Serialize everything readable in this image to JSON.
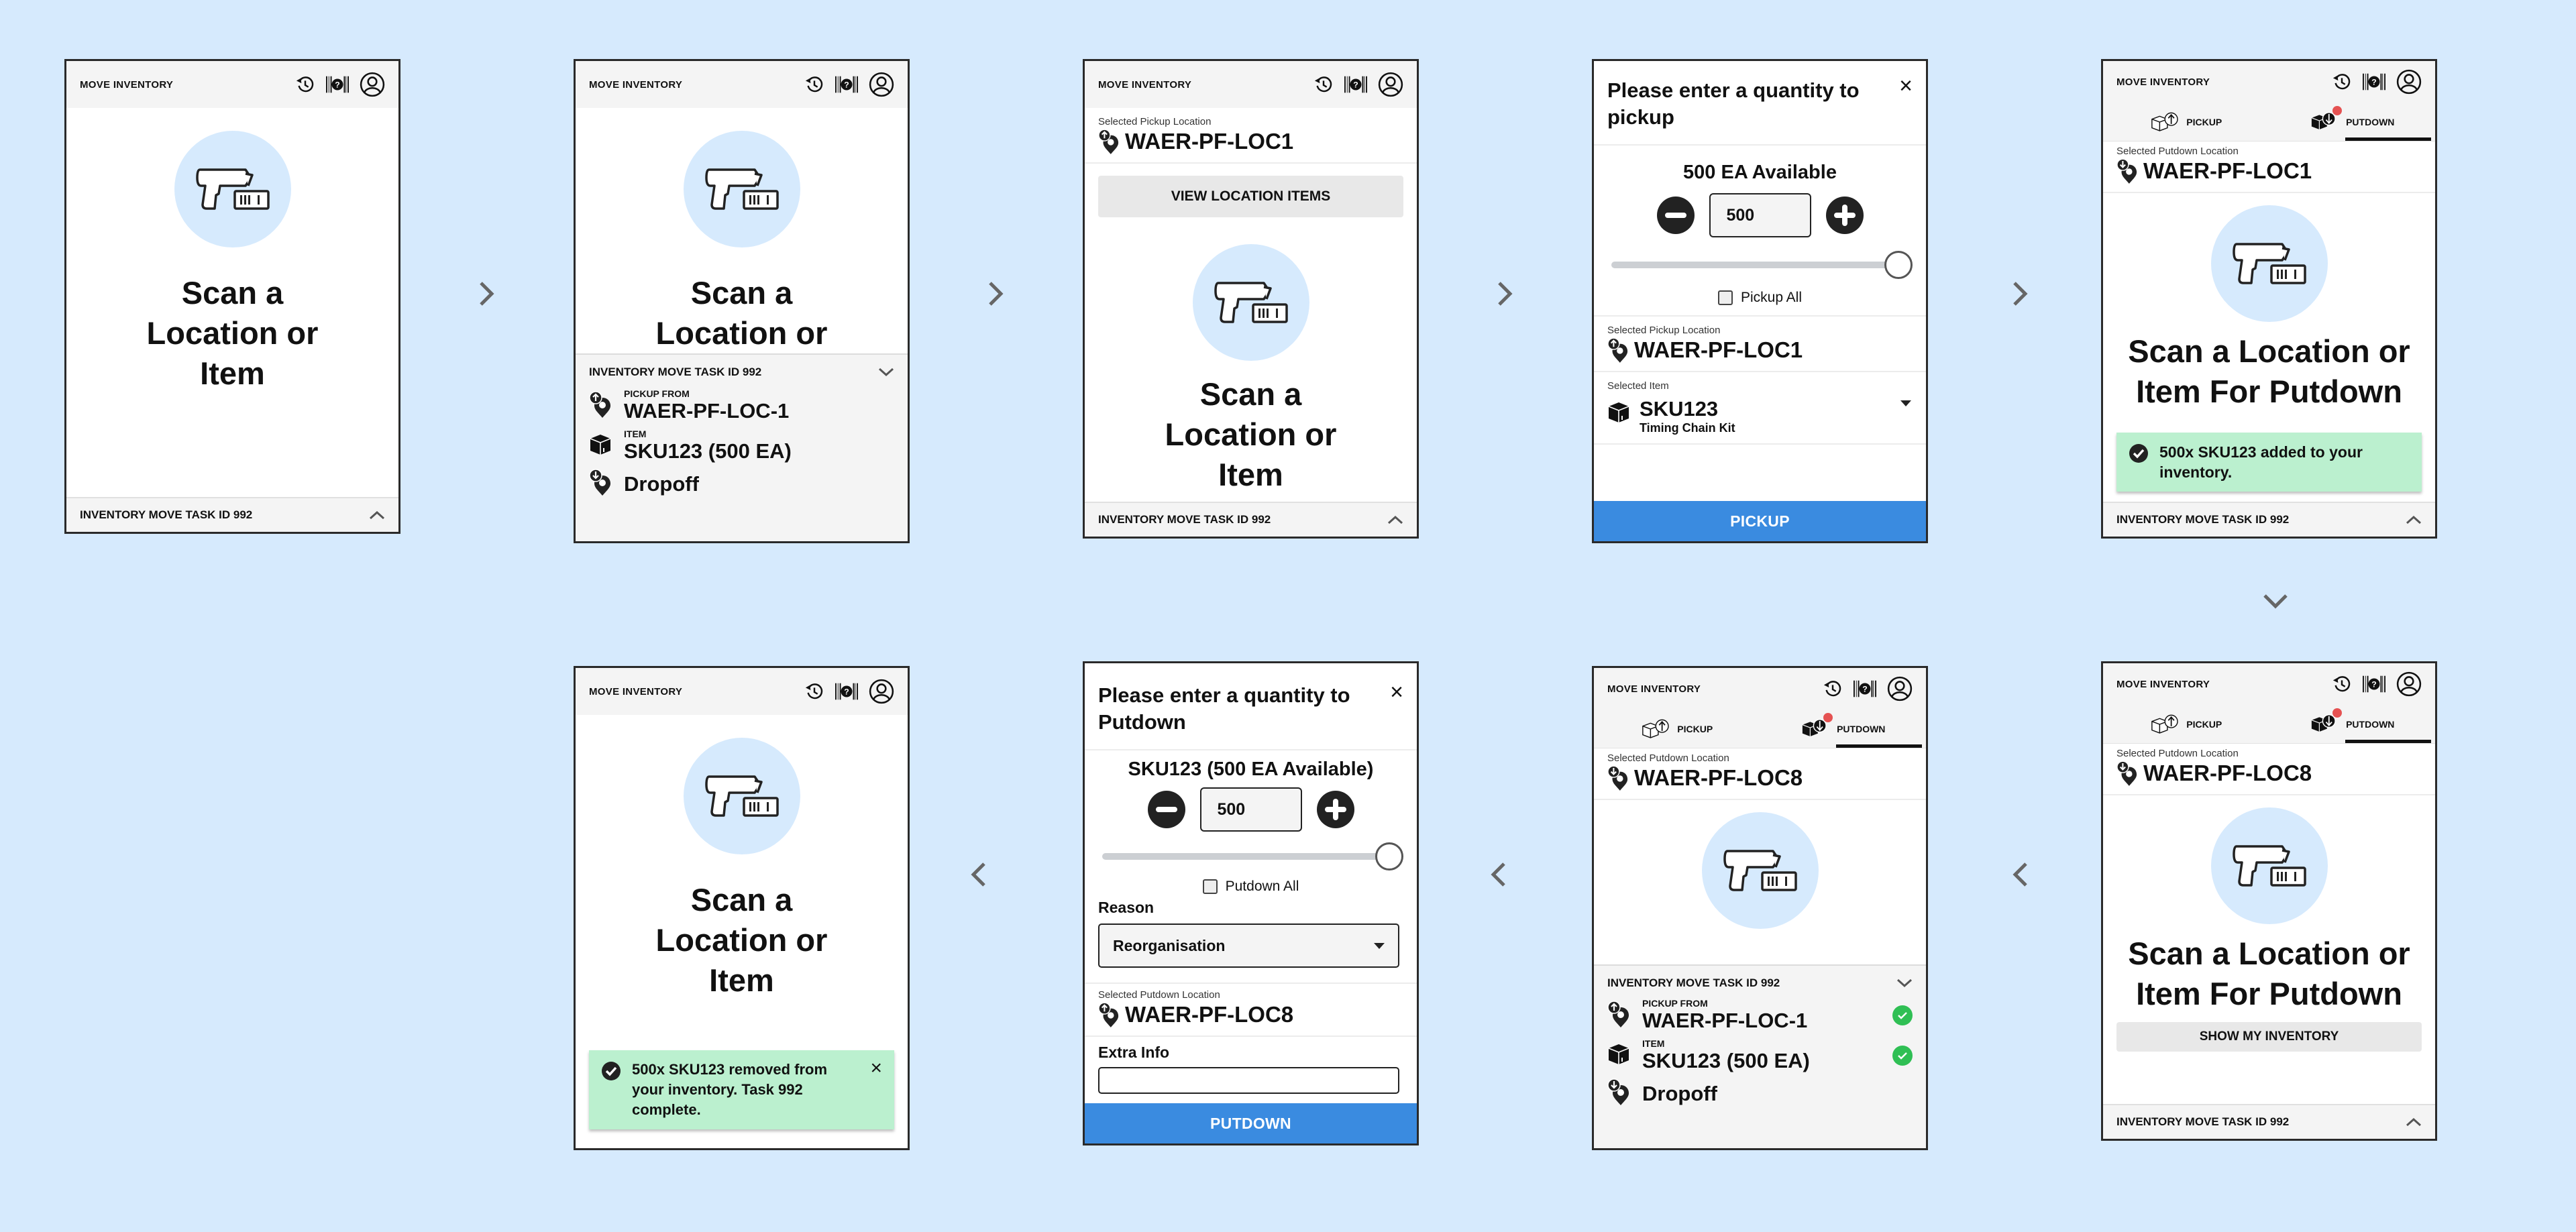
{
  "app": {
    "title": "MOVE INVENTORY",
    "header_icons": [
      "history-icon",
      "barcode-help-icon",
      "user-account-icon"
    ],
    "task_label": "INVENTORY MOVE TASK ID 992",
    "scan_prompt": "Scan a Location or Item",
    "scan_prompt_putdown": "Scan a Location or Item For Putdown",
    "tabs": [
      {
        "label": "PICKUP",
        "icon": "box-pickup-icon",
        "active": false
      },
      {
        "label": "PUTDOWN",
        "icon": "box-putdown-icon",
        "active": true,
        "badge": true
      }
    ]
  },
  "colors": {
    "background": "#d6eafd",
    "primary_button": "#3a8be0",
    "success_toast": "#bbf0cf",
    "success_check": "#2fbf54",
    "badge": "#e55252"
  },
  "flow_arrows": [
    "chevron-right",
    "chevron-right",
    "chevron-right",
    "chevron-right",
    "chevron-down",
    "chevron-left",
    "chevron-left",
    "chevron-left"
  ],
  "screens": [
    {
      "id": 1,
      "task_bar": "INVENTORY MOVE TASK ID 992"
    },
    {
      "id": 2,
      "task_panel": {
        "title": "INVENTORY MOVE TASK ID 992",
        "pickup_label": "PICKUP FROM",
        "pickup_value": "WAER-PF-LOC-1",
        "item_label": "ITEM",
        "item_value": "SKU123 (500 EA)",
        "dropoff_value": "Dropoff"
      }
    },
    {
      "id": 3,
      "selected_label": "Selected Pickup Location",
      "selected_value": "WAER-PF-LOC1",
      "button": "VIEW LOCATION ITEMS",
      "task_bar": "INVENTORY MOVE TASK ID 992"
    },
    {
      "id": 4,
      "modal_title": "Please enter a quantity to pickup",
      "close": "×",
      "available": "500 EA Available",
      "quantity": "500",
      "slider_fraction": 1.0,
      "checkbox_label": "Pickup All",
      "checkbox_checked": false,
      "location_label": "Selected Pickup Location",
      "location_value": "WAER-PF-LOC1",
      "item_label": "Selected Item",
      "item_sku": "SKU123",
      "item_name": "Timing Chain Kit",
      "primary_button": "PICKUP"
    },
    {
      "id": 5,
      "selected_label": "Selected Putdown Location",
      "selected_value": "WAER-PF-LOC1",
      "toast": "500x SKU123 added to your inventory.",
      "task_bar": "INVENTORY MOVE TASK ID 992"
    },
    {
      "id": 6,
      "selected_label": "Selected Putdown Location",
      "selected_value": "WAER-PF-LOC8",
      "button": "SHOW MY INVENTORY",
      "task_bar": "INVENTORY MOVE TASK ID 992"
    },
    {
      "id": 7,
      "selected_label": "Selected Putdown Location",
      "selected_value": "WAER-PF-LOC8",
      "task_panel": {
        "title": "INVENTORY MOVE TASK ID 992",
        "pickup_label": "PICKUP FROM",
        "pickup_value": "WAER-PF-LOC-1",
        "item_label": "ITEM",
        "item_value": "SKU123 (500 EA)",
        "dropoff_value": "Dropoff"
      }
    },
    {
      "id": 8,
      "modal_title": "Please enter a quantity to Putdown",
      "close": "×",
      "available": "SKU123 (500 EA Available)",
      "quantity": "500",
      "slider_fraction": 1.0,
      "checkbox_label": "Putdown All",
      "checkbox_checked": false,
      "reason_label": "Reason",
      "reason_value": "Reorganisation",
      "location_label": "Selected Putdown Location",
      "location_value": "WAER-PF-LOC8",
      "extra_label": "Extra Info",
      "primary_button": "PUTDOWN"
    },
    {
      "id": 9,
      "toast": "500x SKU123 removed from your inventory. Task 992 complete.",
      "toast_close": "×"
    }
  ]
}
